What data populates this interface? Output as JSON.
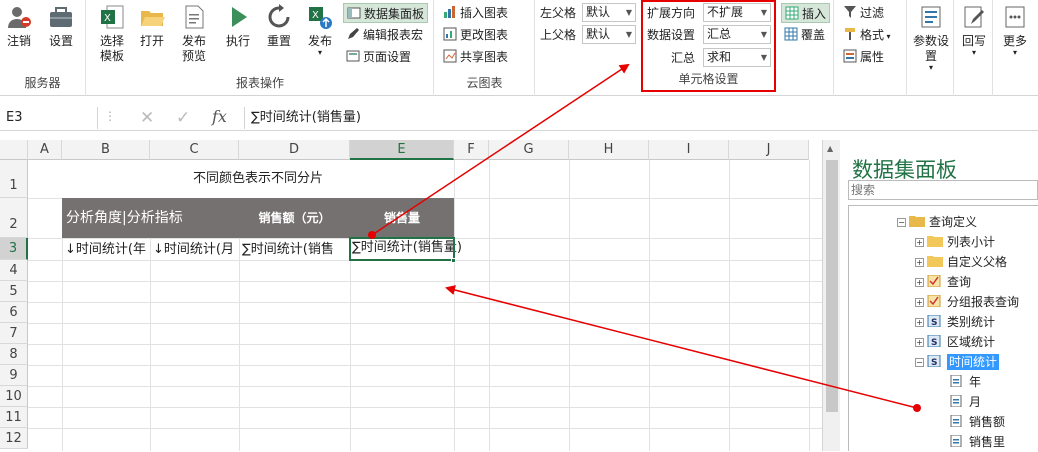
{
  "ribbon": {
    "groups": {
      "server": "服务器",
      "report_ops": "报表操作",
      "cloud_chart": "云图表",
      "cell_settings": "单元格设置"
    },
    "buttons": {
      "logout": "注销",
      "settings": "设置",
      "select_template": "选择\n模板",
      "open": "打开",
      "publish_preview": "发布\n预览",
      "execute": "执行",
      "redo": "重置",
      "publish": "发布",
      "dataset_panel": "数据集面板",
      "edit_report_macro": "编辑报表宏",
      "page_settings": "页面设置",
      "insert_chart": "插入图表",
      "update_chart": "更改图表",
      "share_chart": "共享图表",
      "insert": "插入",
      "cover": "覆盖",
      "filter": "过滤",
      "format": "格式",
      "properties": "属性",
      "param_settings": "参数设置",
      "writeback": "回写",
      "more": "更多"
    },
    "fields": {
      "left_parent_label": "左父格",
      "left_parent_value": "默认",
      "top_parent_label": "上父格",
      "top_parent_value": "默认",
      "expand_dir_label": "扩展方向",
      "expand_dir_value": "不扩展",
      "data_settings_label": "数据设置",
      "data_settings_value": "汇总",
      "summary_label": "汇总",
      "summary_value": "求和"
    },
    "accent_color": "#217346",
    "highlight_color": "#e60000"
  },
  "formula_bar": {
    "name_box": "E3",
    "fx": "fx",
    "cancel": "✕",
    "confirm": "✓",
    "formula": "∑时间统计(销售量)"
  },
  "sheet": {
    "columns": [
      "A",
      "B",
      "C",
      "D",
      "E",
      "F",
      "G",
      "H",
      "I",
      "J"
    ],
    "rows": [
      "1",
      "2",
      "3",
      "4",
      "5",
      "6",
      "7",
      "8",
      "9",
      "10",
      "11",
      "12"
    ],
    "title": "不同颜色表示不同分片",
    "header_b": "分析角度|分析指标",
    "header_d": "销售额（元）",
    "header_e": "销售量",
    "c_b3": "↓时间统计(年",
    "c_c3": "↓时间统计(月",
    "c_d3": "∑时间统计(销售",
    "c_e3": "∑时间统计(销售量)",
    "header_fill": "#767171",
    "selected_cell": "E3"
  },
  "panel": {
    "title": "数据集面板",
    "search_placeholder": "搜索",
    "tree": {
      "query_def": "查询定义",
      "list_subtotal": "列表小计",
      "custom_parent": "自定义父格",
      "query": "查询",
      "group_query": "分组报表查询",
      "category_stats": "类别统计",
      "region_stats": "区域统计",
      "time_stats": "时间统计",
      "year": "年",
      "month": "月",
      "sales_amount": "销售额",
      "sales_volume": "销售里"
    }
  }
}
